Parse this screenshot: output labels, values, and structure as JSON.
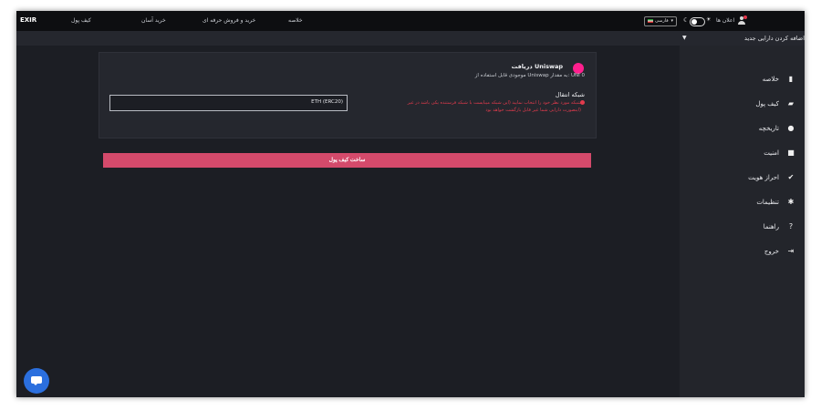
{
  "topbar": {
    "logo": "EXIR",
    "nav": [
      "کیف پول",
      "خرید آسان",
      "خرید و فروش حرفه ای",
      "خلاصه"
    ],
    "language": "فارسی",
    "notifications_label": "اعلان ها",
    "notif_count": "1"
  },
  "subbar": {
    "add_asset": "اضافه کردن دارایی جدید"
  },
  "sidebar": {
    "items": [
      {
        "label": "خلاصه",
        "icon": "bar-chart-icon"
      },
      {
        "label": "کیف پول",
        "icon": "wallet-icon"
      },
      {
        "label": "تاریخچه",
        "icon": "history-icon"
      },
      {
        "label": "امنیت",
        "icon": "lock-icon"
      },
      {
        "label": "احراز هویت",
        "icon": "verified-icon"
      },
      {
        "label": "تنظیمات",
        "icon": "gear-icon"
      },
      {
        "label": "راهنما",
        "icon": "help-icon"
      },
      {
        "label": "خروج",
        "icon": "logout-icon"
      }
    ]
  },
  "receive": {
    "title": "دریافت Uniswap",
    "subtitle": "موجودی قابل استفاده از Uniswap به مقدار: UNI 0",
    "network_label": "شبکه انتقال",
    "network_value": "ETH (ERC20)",
    "warning_line1": "شبکه مورد نظر خود را انتخاب نمایید (این شبکه میبایست با شبکه فرستنده یکی باشد در غیر",
    "warning_line2": "اینصورت دارایی شما غیر قابل بازگشت خواهد بود)",
    "accent_color": "#ff1f8e"
  },
  "actions": {
    "create_wallet": "ساخت کیف پول",
    "button_color": "#d44a6b"
  }
}
